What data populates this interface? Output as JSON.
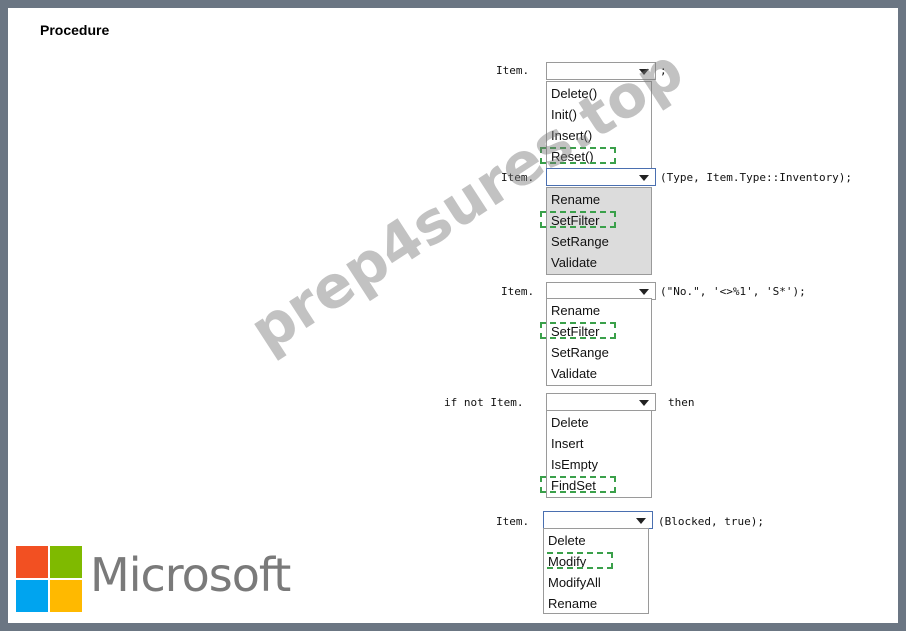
{
  "title": "Procedure",
  "rows": [
    {
      "prefix": "Item.",
      "suffix": ";",
      "options": [
        "Delete()",
        "Init()",
        "Insert()",
        "Reset()"
      ],
      "selected": 3
    },
    {
      "prefix": "Item.",
      "suffix": "(Type, Item.Type::Inventory);",
      "options": [
        "Rename",
        "SetFilter",
        "SetRange",
        "Validate"
      ],
      "selected": 1
    },
    {
      "prefix": "Item.",
      "suffix": "(\"No.\", '<>%1', 'S*');",
      "options": [
        "Rename",
        "SetFilter",
        "SetRange",
        "Validate"
      ],
      "selected": 1
    },
    {
      "prefix": "if not Item.",
      "suffix": "then",
      "options": [
        "Delete",
        "Insert",
        "IsEmpty",
        "FindSet"
      ],
      "selected": 3
    },
    {
      "prefix": "Item.",
      "suffix": "(Blocked, true);",
      "options": [
        "Delete",
        "Modify",
        "ModifyAll",
        "Rename"
      ],
      "selected": 1
    }
  ],
  "watermark": "prep4sures.top",
  "brand": {
    "name": "Microsoft",
    "colors": {
      "red": "#f25022",
      "green": "#7fba00",
      "blue": "#00a4ef",
      "yellow": "#ffb900"
    }
  },
  "colors": {
    "selection_dash": "#3aa04a",
    "frame": "#6b7683"
  }
}
